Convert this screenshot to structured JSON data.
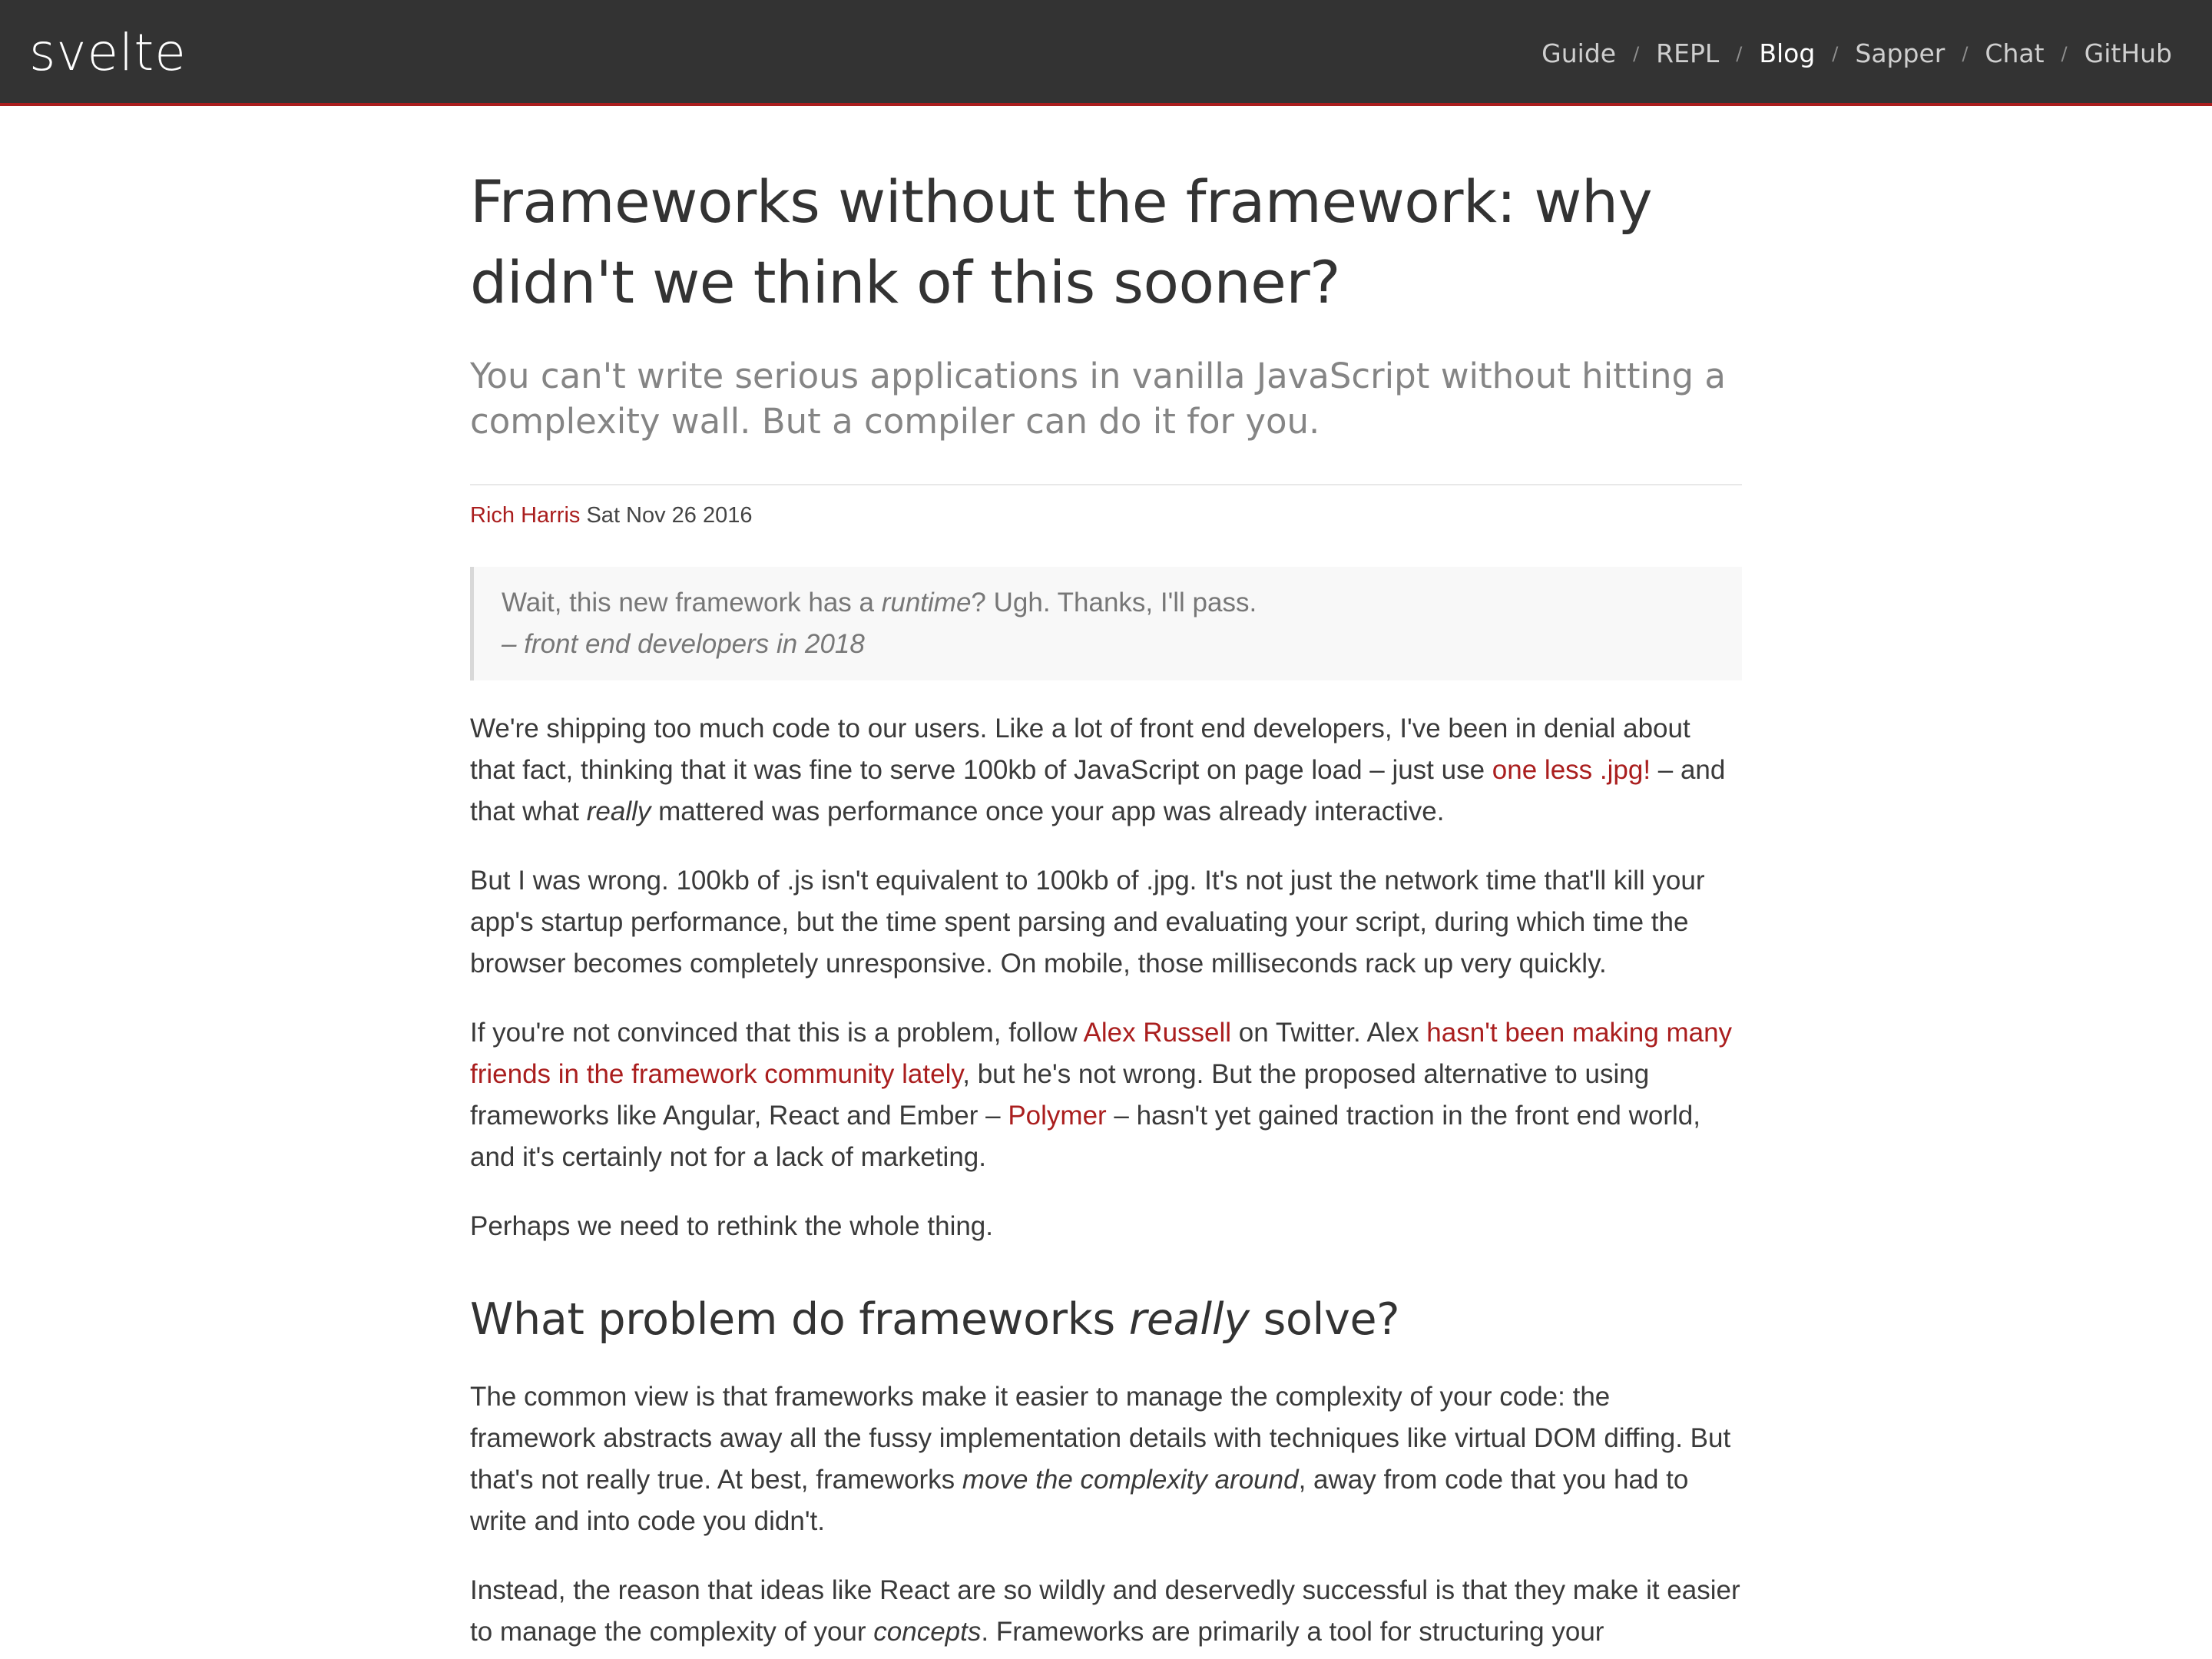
{
  "nav": {
    "logo": "svelte",
    "links": [
      {
        "label": "Guide",
        "active": false
      },
      {
        "label": "REPL",
        "active": false
      },
      {
        "label": "Blog",
        "active": true
      },
      {
        "label": "Sapper",
        "active": false
      },
      {
        "label": "Chat",
        "active": false
      },
      {
        "label": "GitHub",
        "active": false
      }
    ],
    "separator": "/"
  },
  "colors": {
    "nav_bg": "#333333",
    "accent": "#aa1e1e"
  },
  "post": {
    "title": "Frameworks without the framework: why didn't we think of this sooner?",
    "subtitle": "You can't write serious applications in vanilla JavaScript without hitting a complexity wall. But a compiler can do it for you.",
    "author": "Rich Harris",
    "date": "Sat Nov 26 2016",
    "quote": {
      "line1_a": "Wait, this new framework has a ",
      "line1_em": "runtime",
      "line1_b": "? Ugh. Thanks, I'll pass.",
      "line2": "– front end developers in 2018"
    },
    "p1": {
      "a": "We're shipping too much code to our users. Like a lot of front end developers, I've been in denial about that fact, thinking that it was fine to serve 100kb of JavaScript on page load – just use ",
      "link": "one less .jpg!",
      "b": " – and that what ",
      "em": "really",
      "c": " mattered was performance once your app was already interactive."
    },
    "p2": "But I was wrong. 100kb of .js isn't equivalent to 100kb of .jpg. It's not just the network time that'll kill your app's startup performance, but the time spent parsing and evaluating your script, during which time the browser becomes completely unresponsive. On mobile, those milliseconds rack up very quickly.",
    "p3": {
      "a": "If you're not convinced that this is a problem, follow ",
      "link1": "Alex Russell",
      "b": " on Twitter. Alex ",
      "link2": "hasn't been making many friends in the framework community lately",
      "c": ", but he's not wrong. But the proposed alternative to using frameworks like Angular, React and Ember – ",
      "link3": "Polymer",
      "d": " – hasn't yet gained traction in the front end world, and it's certainly not for a lack of marketing."
    },
    "p4": "Perhaps we need to rethink the whole thing.",
    "h2": {
      "a": "What problem do frameworks ",
      "em": "really",
      "b": " solve?"
    },
    "p5": {
      "a": "The common view is that frameworks make it easier to manage the complexity of your code: the framework abstracts away all the fussy implementation details with techniques like virtual DOM diffing. But that's not really true. At best, frameworks ",
      "em": "move the complexity around",
      "b": ", away from code that you had to write and into code you didn't."
    },
    "p6": {
      "a": "Instead, the reason that ideas like React are so wildly and deservedly successful is that they make it easier to manage the complexity of your ",
      "em": "concepts",
      "b": ". Frameworks are primarily a tool for structuring your"
    }
  }
}
